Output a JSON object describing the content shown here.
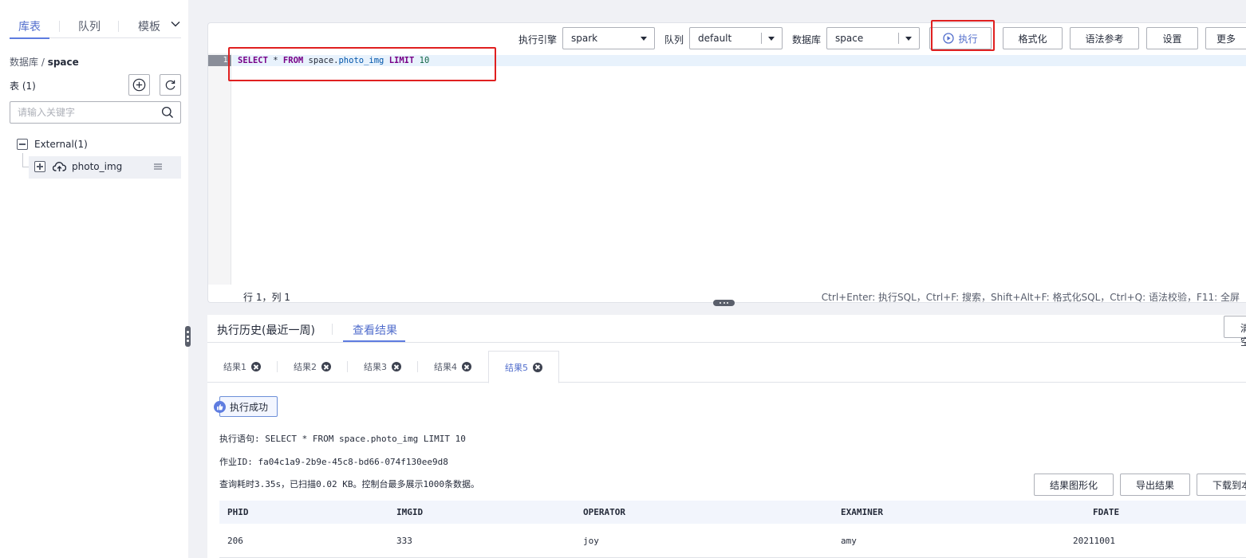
{
  "left_panel": {
    "tabs": [
      {
        "label": "库表",
        "active": true
      },
      {
        "label": "队列",
        "active": false
      },
      {
        "label": "模板",
        "active": false
      }
    ],
    "breadcrumb_prefix": "数据库 / ",
    "breadcrumb_db": "space",
    "table_count_label": "表 (1)",
    "search_placeholder": "请输入关键字",
    "tree": {
      "group_label": "External(1)",
      "table_label": "photo_img"
    }
  },
  "toolbar": {
    "engine_label": "执行引擎",
    "engine_value": "spark",
    "queue_label": "队列",
    "queue_value": "default",
    "database_label": "数据库",
    "database_value": "space",
    "run_label": "执行",
    "format_label": "格式化",
    "syntax_label": "语法参考",
    "settings_label": "设置",
    "more_label": "更多"
  },
  "editor": {
    "line_number": "1",
    "code_tokens": {
      "select": "SELECT",
      "star": "*",
      "from": "FROM",
      "schema": "space.",
      "table": "photo_img",
      "limit": "LIMIT",
      "count": "10"
    },
    "status_position": "行 1，列 1",
    "status_shortcuts": "Ctrl+Enter: 执行SQL，Ctrl+F: 搜索，Shift+Alt+F: 格式化SQL，Ctrl+Q: 语法校验，F11: 全屏"
  },
  "results": {
    "tabs": [
      {
        "label": "执行历史(最近一周)",
        "active": false
      },
      {
        "label": "查看结果",
        "active": true
      }
    ],
    "clear_label": "清空",
    "result_tabs": [
      "结果1",
      "结果2",
      "结果3",
      "结果4",
      "结果5"
    ],
    "active_result": "结果5",
    "success_label": "执行成功",
    "statement_line": "执行语句: SELECT * FROM space.photo_img LIMIT 10",
    "job_id_line": "作业ID: fa04c1a9-2b9e-45c8-bd66-074f130ee9d8",
    "summary_line": "查询耗时3.35s，已扫描0.02 KB。控制台最多展示1000条数据。",
    "chart_btn": "结果图形化",
    "export_btn": "导出结果",
    "download_btn": "下载到本地",
    "columns": [
      "PHID",
      "IMGID",
      "OPERATOR",
      "EXAMINER",
      "FDATE"
    ],
    "rows": [
      [
        "206",
        "333",
        "joy",
        "amy",
        "20211001"
      ]
    ]
  },
  "colors": {
    "accent": "#5e7ce0",
    "highlight_box": "#e02020"
  }
}
